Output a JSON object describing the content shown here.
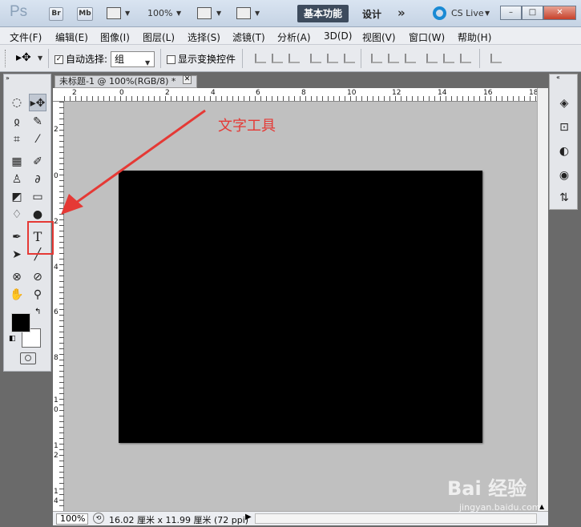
{
  "titlebar": {
    "app_logo": "Ps",
    "bridge_label": "Br",
    "minibridge_label": "Mb",
    "zoom_value": "100%",
    "workspace_active": "基本功能",
    "workspace_other": "设计",
    "more_label": "»",
    "cslive_label": "CS Live",
    "min_label": "–",
    "max_label": "□",
    "close_label": "✕"
  },
  "menu": [
    "文件(F)",
    "编辑(E)",
    "图像(I)",
    "图层(L)",
    "选择(S)",
    "滤镜(T)",
    "分析(A)",
    "3D(D)",
    "视图(V)",
    "窗口(W)",
    "帮助(H)"
  ],
  "options": {
    "auto_select_label": "自动选择:",
    "auto_select_checked": "✓",
    "auto_select_value": "组",
    "show_transform_label": "显示变换控件"
  },
  "document": {
    "tab_title": "未标题-1 @ 100%(RGB/8) *",
    "tab_close": "✕",
    "canvas_color": "#000000"
  },
  "ruler": {
    "top_labels": [
      "2",
      "0",
      "2",
      "4",
      "6",
      "8",
      "10",
      "12",
      "14",
      "16",
      "18"
    ],
    "left_labels": [
      "2",
      "0",
      "2",
      "4",
      "6",
      "8",
      "1",
      "0",
      "1",
      "2",
      "1",
      "4"
    ]
  },
  "status": {
    "zoom": "100%",
    "info": "16.02 厘米 x 11.99 厘米 (72 ppi)"
  },
  "annotation": {
    "text": "文字工具",
    "color": "#e53935"
  },
  "watermark": {
    "main": "Bai 经验",
    "sub": "jingyan.baidu.com"
  }
}
